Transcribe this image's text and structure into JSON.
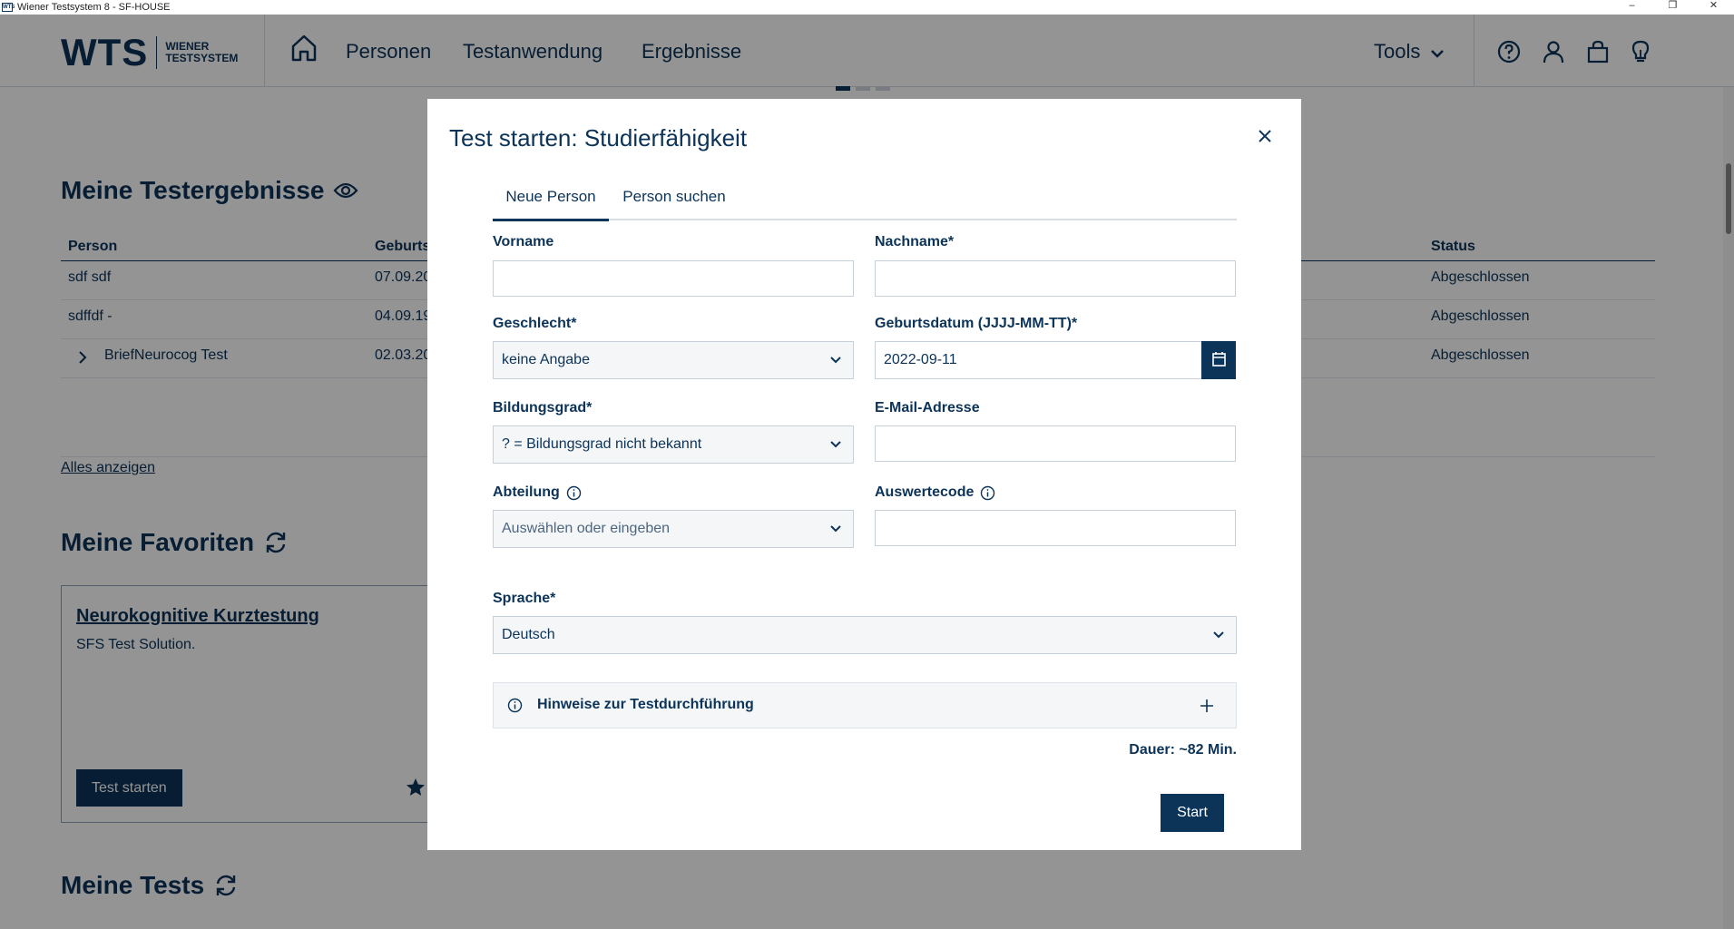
{
  "window": {
    "title": "Wiener Testsystem 8 - SF-HOUSE",
    "app_icon_text": "WTS",
    "buttons": [
      "–",
      "❐",
      "✕"
    ]
  },
  "brand": {
    "logo": "WTS",
    "sub_line1": "WIENER",
    "sub_line2": "TESTSYSTEM",
    "color": "#0c3358"
  },
  "nav": {
    "items": [
      "Personen",
      "Testanwendung",
      "Ergebnisse"
    ],
    "tools": "Tools"
  },
  "results": {
    "title": "Meine Testergebnisse",
    "headers": {
      "person": "Person",
      "geburt": "Geburts",
      "status": "Status"
    },
    "rows": [
      {
        "person": "sdf sdf",
        "geburt": "07.09.20",
        "status": "Abgeschlossen"
      },
      {
        "person": "sdffdf -",
        "geburt": "04.09.19",
        "status": "Abgeschlossen"
      },
      {
        "person": "BriefNeurocog Test",
        "geburt": "02.03.20",
        "status": "Abgeschlossen"
      }
    ],
    "show_all": "Alles anzeigen"
  },
  "favorites": {
    "title": "Meine Favoriten",
    "card": {
      "title": "Neurokognitive Kurztestung",
      "desc": "SFS Test Solution.",
      "button": "Test starten"
    }
  },
  "tests": {
    "title": "Meine Tests"
  },
  "modal": {
    "title": "Test starten: Studierfähigkeit",
    "tabs": [
      "Neue Person",
      "Person suchen"
    ],
    "fields": {
      "vorname": {
        "label": "Vorname",
        "value": ""
      },
      "nachname": {
        "label": "Nachname*",
        "value": ""
      },
      "geschlecht": {
        "label": "Geschlecht*",
        "value": "keine Angabe"
      },
      "geburtsdatum": {
        "label": "Geburtsdatum (JJJJ-MM-TT)*",
        "value": "2022-09-11"
      },
      "bildungsgrad": {
        "label": "Bildungsgrad*",
        "value": "? = Bildungsgrad nicht bekannt"
      },
      "email": {
        "label": "E-Mail-Adresse",
        "value": ""
      },
      "abteilung": {
        "label": "Abteilung",
        "placeholder": "Auswählen oder eingeben"
      },
      "auswertecode": {
        "label": "Auswertecode",
        "value": ""
      },
      "sprache": {
        "label": "Sprache*",
        "value": "Deutsch"
      }
    },
    "hint": "Hinweise zur Testdurchführung",
    "duration": "Dauer: ~82 Min.",
    "start": "Start"
  }
}
